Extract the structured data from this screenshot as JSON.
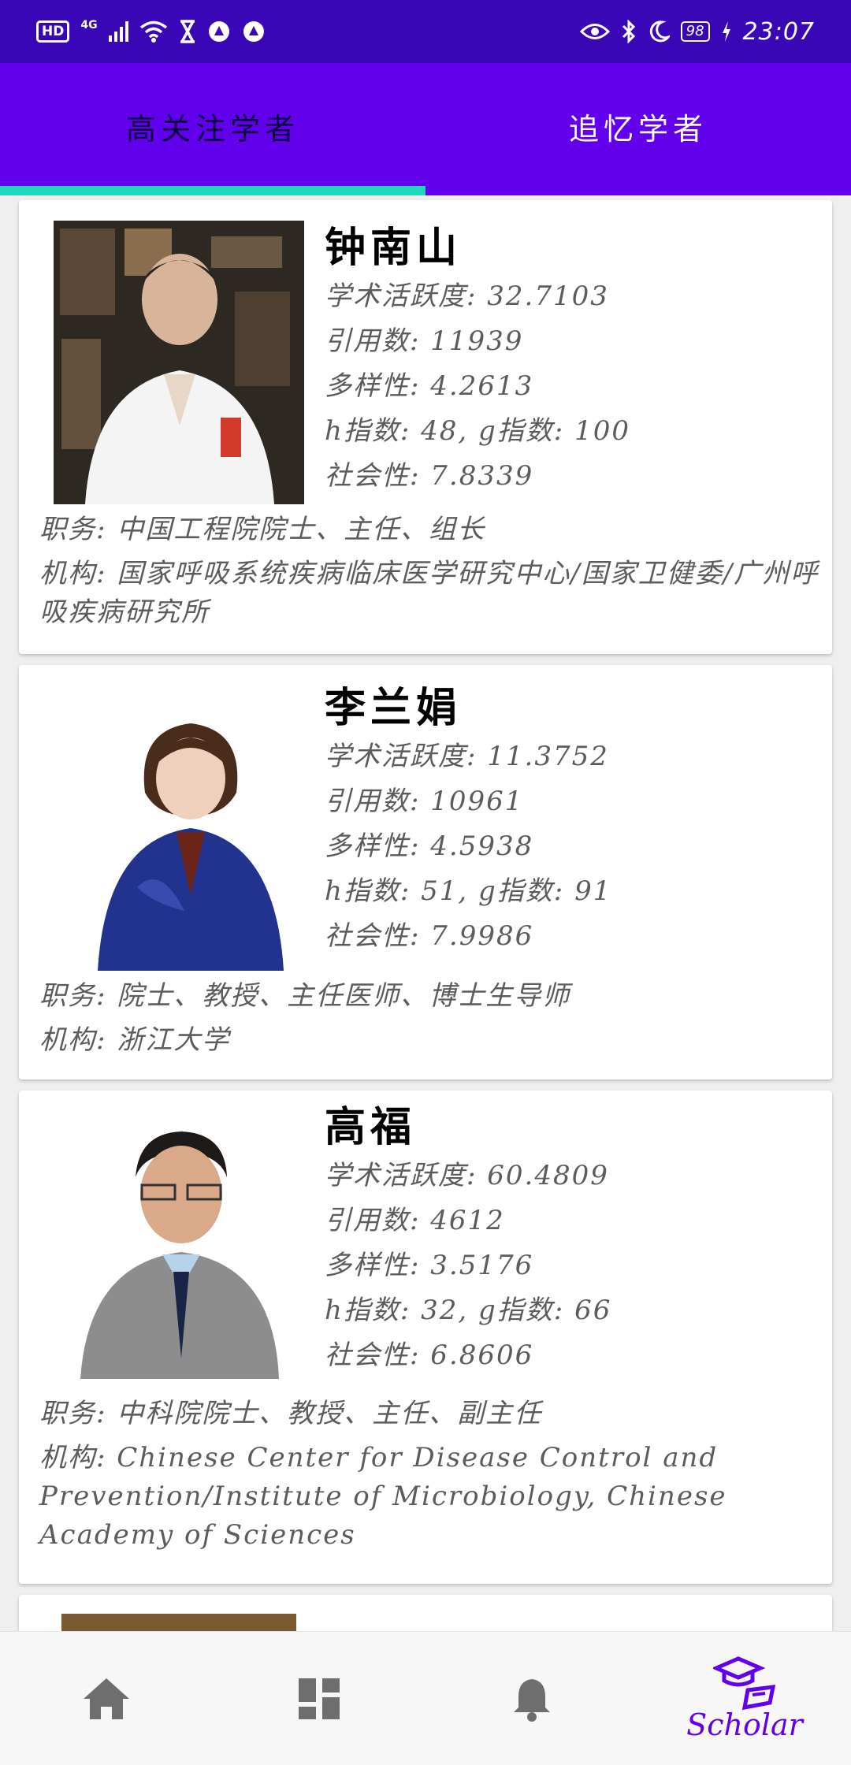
{
  "status_bar": {
    "hd": "HD",
    "network": "4G",
    "battery": "98",
    "time": "23:07"
  },
  "tabs": [
    {
      "label": "高关注学者",
      "active": true
    },
    {
      "label": "追忆学者",
      "active": false
    }
  ],
  "scholars": [
    {
      "name": "钟南山",
      "activity": "学术活跃度: 32.7103",
      "citations": "引用数: 11939",
      "diversity": "多样性: 4.2613",
      "indices": "h指数: 48, g指数: 100",
      "sociability": "社会性: 7.8339",
      "position": "职务: 中国工程院院士、主任、组长",
      "institution": "机构: 国家呼吸系统疾病临床医学研究中心/国家卫健委/广州呼吸疾病研究所"
    },
    {
      "name": "李兰娟",
      "activity": "学术活跃度: 11.3752",
      "citations": "引用数: 10961",
      "diversity": "多样性: 4.5938",
      "indices": "h指数: 51, g指数: 91",
      "sociability": "社会性: 7.9986",
      "position": "职务: 院士、教授、主任医师、博士生导师",
      "institution": "机构: 浙江大学"
    },
    {
      "name": "高福",
      "activity": "学术活跃度: 60.4809",
      "citations": "引用数: 4612",
      "diversity": "多样性: 3.5176",
      "indices": "h指数: 32, g指数: 66",
      "sociability": "社会性: 6.8606",
      "position": "职务: 中科院院士、教授、主任、副主任",
      "institution": "机构: Chinese Center for Disease Control and Prevention/Institute of Microbiology, Chinese Academy of Sciences"
    }
  ],
  "bottom_nav": [
    {
      "icon": "home-icon",
      "label": ""
    },
    {
      "icon": "dashboard-icon",
      "label": ""
    },
    {
      "icon": "bell-icon",
      "label": ""
    },
    {
      "icon": "scholar-cap-icon",
      "label": "Scholar",
      "active": true
    }
  ],
  "colors": {
    "status_bar": "#3a07b7",
    "primary": "#6200ee",
    "tab_indicator": "#1ed9b9",
    "nav_icon": "#6e6e6e"
  }
}
